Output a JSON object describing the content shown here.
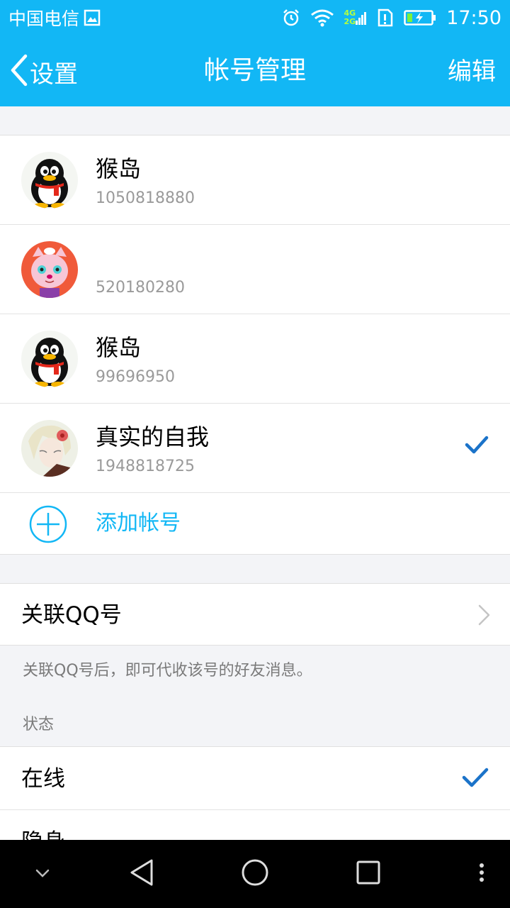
{
  "status_bar": {
    "carrier": "中国电信",
    "net_top": "4G",
    "net_bottom": "2G",
    "time": "17:50"
  },
  "nav": {
    "back_label": "设置",
    "title": "帐号管理",
    "edit_label": "编辑"
  },
  "accounts": [
    {
      "name": "猴岛",
      "number": "1050818880",
      "avatar": "penguin-avatar",
      "selected": false
    },
    {
      "name": "",
      "number": "520180280",
      "avatar": "cat-avatar",
      "selected": false
    },
    {
      "name": "猴岛",
      "number": "99696950",
      "avatar": "penguin-avatar",
      "selected": false
    },
    {
      "name": "真实的自我",
      "number": "1948818725",
      "avatar": "anime-avatar",
      "selected": true
    }
  ],
  "add_account_label": "添加帐号",
  "link_qq": {
    "label": "关联QQ号",
    "description": "关联QQ号后，即可代收该号的好友消息。"
  },
  "status_section": {
    "title": "状态",
    "options": [
      {
        "label": "在线",
        "selected": true
      },
      {
        "label": "隐身",
        "selected": false
      }
    ]
  },
  "colors": {
    "accent": "#12b7f5",
    "check": "#1b73c9"
  }
}
